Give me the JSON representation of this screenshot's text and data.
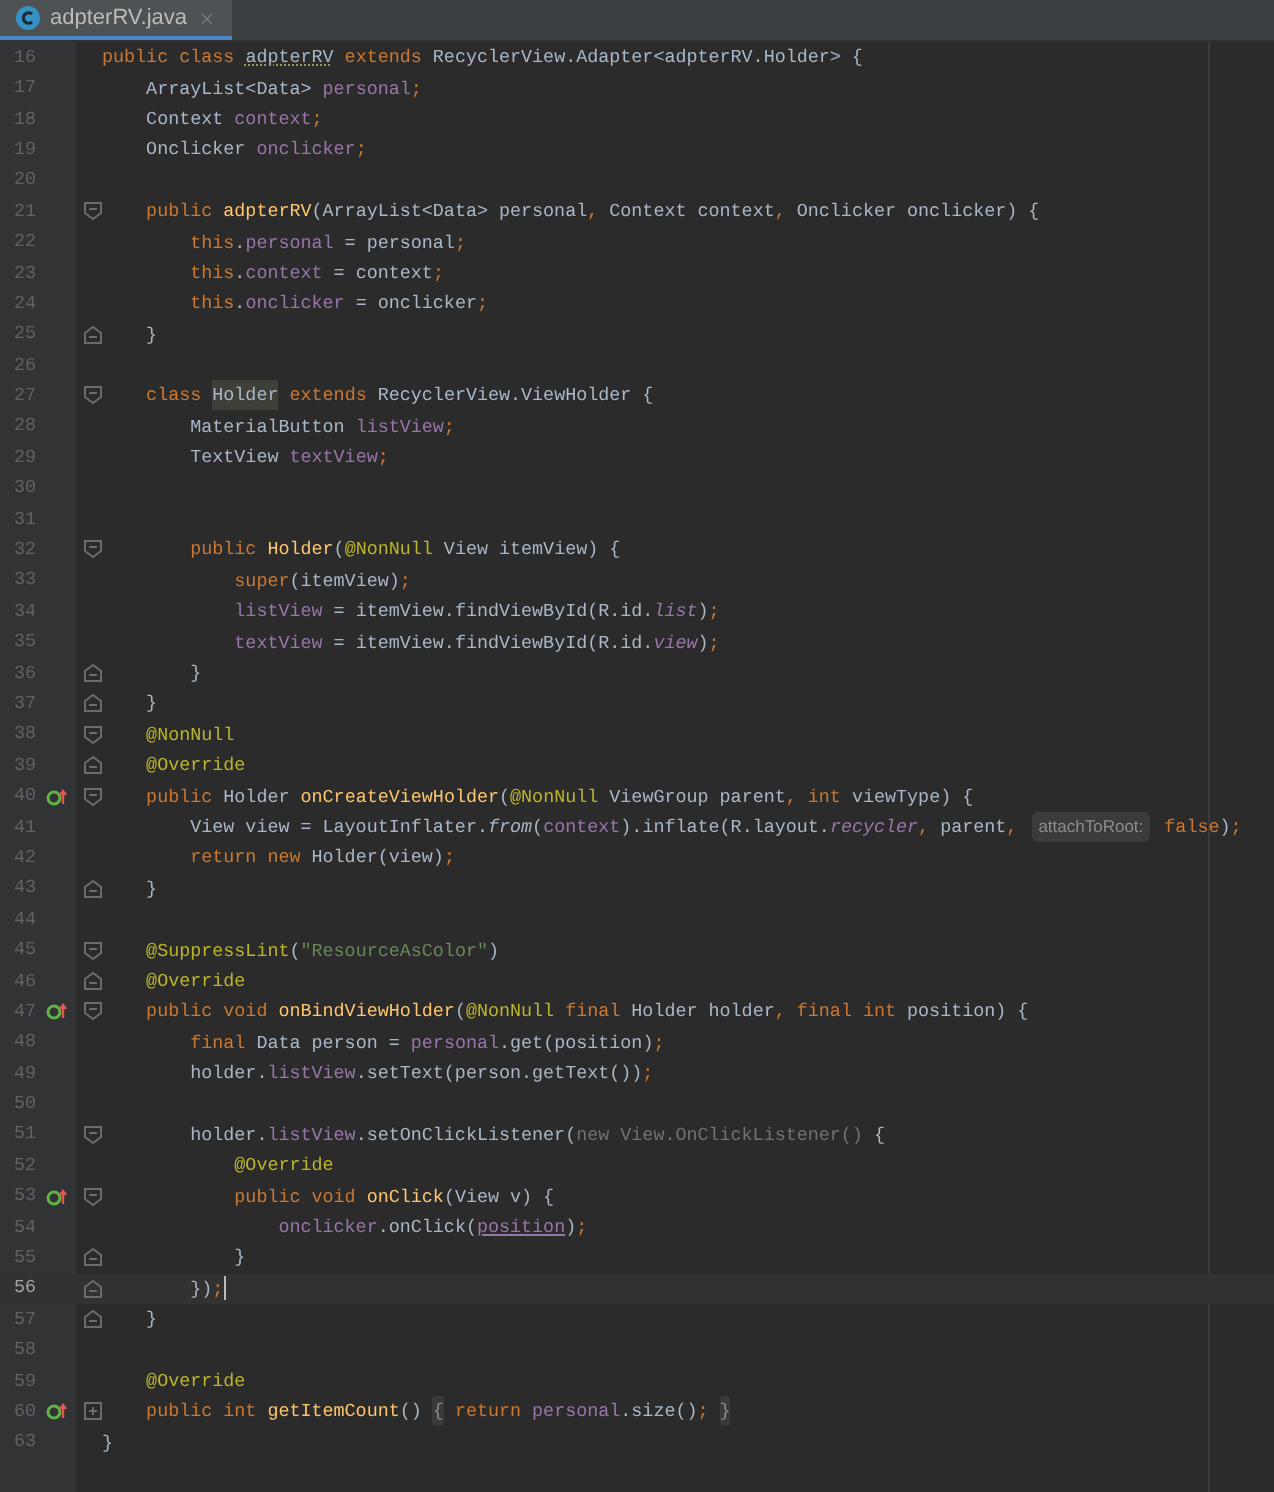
{
  "tab": {
    "title": "adpterRV.java",
    "selected": true
  },
  "lines": [
    {
      "number": "16",
      "current": false,
      "overrides": false,
      "tokens": [
        {
          "kind": "kw",
          "text": "public class "
        },
        {
          "kind": "typo",
          "text": "adpterRV"
        },
        {
          "kind": "kw",
          "text": " extends "
        },
        {
          "kind": "plain",
          "text": "RecyclerView.Adapter<adpterRV.Holder> {"
        }
      ]
    },
    {
      "number": "17",
      "current": false,
      "overrides": false,
      "tokens": [
        {
          "kind": "plain",
          "text": "    ArrayList<Data> "
        },
        {
          "kind": "field",
          "text": "personal"
        },
        {
          "kind": "kw",
          "text": ";"
        }
      ]
    },
    {
      "number": "18",
      "current": false,
      "overrides": false,
      "tokens": [
        {
          "kind": "plain",
          "text": "    Context "
        },
        {
          "kind": "field",
          "text": "context"
        },
        {
          "kind": "kw",
          "text": ";"
        }
      ]
    },
    {
      "number": "19",
      "current": false,
      "overrides": false,
      "tokens": [
        {
          "kind": "plain",
          "text": "    Onclicker "
        },
        {
          "kind": "field",
          "text": "onclicker"
        },
        {
          "kind": "kw",
          "text": ";"
        }
      ]
    },
    {
      "number": "20",
      "current": false,
      "overrides": false
    },
    {
      "number": "21",
      "current": false,
      "overrides": false,
      "fold_marker": {
        "kind": "start"
      },
      "tokens": [
        {
          "kind": "kw",
          "text": "    public "
        },
        {
          "kind": "method",
          "text": "adpterRV"
        },
        {
          "kind": "plain",
          "text": "(ArrayList<Data> personal"
        },
        {
          "kind": "kw",
          "text": ", "
        },
        {
          "kind": "plain",
          "text": "Context context"
        },
        {
          "kind": "kw",
          "text": ", "
        },
        {
          "kind": "plain",
          "text": "Onclicker onclicker) {"
        }
      ]
    },
    {
      "number": "22",
      "current": false,
      "overrides": false,
      "tokens": [
        {
          "kind": "kw",
          "text": "        this"
        },
        {
          "kind": "plain",
          "text": "."
        },
        {
          "kind": "field",
          "text": "personal"
        },
        {
          "kind": "plain",
          "text": " = personal"
        },
        {
          "kind": "kw",
          "text": ";"
        }
      ]
    },
    {
      "number": "23",
      "current": false,
      "overrides": false,
      "tokens": [
        {
          "kind": "kw",
          "text": "        this"
        },
        {
          "kind": "plain",
          "text": "."
        },
        {
          "kind": "field",
          "text": "context"
        },
        {
          "kind": "plain",
          "text": " = context"
        },
        {
          "kind": "kw",
          "text": ";"
        }
      ]
    },
    {
      "number": "24",
      "current": false,
      "overrides": false,
      "tokens": [
        {
          "kind": "kw",
          "text": "        this"
        },
        {
          "kind": "plain",
          "text": "."
        },
        {
          "kind": "field",
          "text": "onclicker"
        },
        {
          "kind": "plain",
          "text": " = onclicker"
        },
        {
          "kind": "kw",
          "text": ";"
        }
      ]
    },
    {
      "number": "25",
      "current": false,
      "overrides": false,
      "fold_marker": {
        "kind": "end"
      },
      "tokens": [
        {
          "kind": "plain",
          "text": "    }"
        }
      ]
    },
    {
      "number": "26",
      "current": false,
      "overrides": false
    },
    {
      "number": "27",
      "current": false,
      "overrides": false,
      "fold_marker": {
        "kind": "start"
      },
      "tokens": [
        {
          "kind": "kw",
          "text": "    class "
        },
        {
          "kind": "usage",
          "text": "Holder"
        },
        {
          "kind": "kw",
          "text": " extends "
        },
        {
          "kind": "plain",
          "text": "RecyclerView.ViewHolder {"
        }
      ]
    },
    {
      "number": "28",
      "current": false,
      "overrides": false,
      "tokens": [
        {
          "kind": "plain",
          "text": "        MaterialButton "
        },
        {
          "kind": "field",
          "text": "listView"
        },
        {
          "kind": "kw",
          "text": ";"
        }
      ]
    },
    {
      "number": "29",
      "current": false,
      "overrides": false,
      "tokens": [
        {
          "kind": "plain",
          "text": "        TextView "
        },
        {
          "kind": "field",
          "text": "textView"
        },
        {
          "kind": "kw",
          "text": ";"
        }
      ]
    },
    {
      "number": "30",
      "current": false,
      "overrides": false
    },
    {
      "number": "31",
      "current": false,
      "overrides": false
    },
    {
      "number": "32",
      "current": false,
      "overrides": false,
      "fold_marker": {
        "kind": "start"
      },
      "tokens": [
        {
          "kind": "kw",
          "text": "        public "
        },
        {
          "kind": "method",
          "text": "Holder"
        },
        {
          "kind": "plain",
          "text": "("
        },
        {
          "kind": "ann",
          "text": "@NonNull"
        },
        {
          "kind": "plain",
          "text": " View itemView) {"
        }
      ]
    },
    {
      "number": "33",
      "current": false,
      "overrides": false,
      "tokens": [
        {
          "kind": "kw",
          "text": "            super"
        },
        {
          "kind": "plain",
          "text": "(itemView)"
        },
        {
          "kind": "kw",
          "text": ";"
        }
      ]
    },
    {
      "number": "34",
      "current": false,
      "overrides": false,
      "tokens": [
        {
          "kind": "field",
          "text": "            listView"
        },
        {
          "kind": "plain",
          "text": " = itemView.findViewById(R.id."
        },
        {
          "kind": "static",
          "text": "list"
        },
        {
          "kind": "plain",
          "text": ")"
        },
        {
          "kind": "kw",
          "text": ";"
        }
      ]
    },
    {
      "number": "35",
      "current": false,
      "overrides": false,
      "tokens": [
        {
          "kind": "field",
          "text": "            textView"
        },
        {
          "kind": "plain",
          "text": " = itemView.findViewById(R.id."
        },
        {
          "kind": "static",
          "text": "view"
        },
        {
          "kind": "plain",
          "text": ")"
        },
        {
          "kind": "kw",
          "text": ";"
        }
      ]
    },
    {
      "number": "36",
      "current": false,
      "overrides": false,
      "fold_marker": {
        "kind": "end"
      },
      "tokens": [
        {
          "kind": "plain",
          "text": "        }"
        }
      ]
    },
    {
      "number": "37",
      "current": false,
      "overrides": false,
      "fold_marker": {
        "kind": "end"
      },
      "tokens": [
        {
          "kind": "plain",
          "text": "    }"
        }
      ]
    },
    {
      "number": "38",
      "current": false,
      "overrides": false,
      "fold_marker": {
        "kind": "start"
      },
      "tokens": [
        {
          "kind": "ann",
          "text": "    @NonNull"
        }
      ]
    },
    {
      "number": "39",
      "current": false,
      "overrides": false,
      "fold_marker": {
        "kind": "end"
      },
      "tokens": [
        {
          "kind": "ann",
          "text": "    @Override"
        }
      ]
    },
    {
      "number": "40",
      "current": false,
      "overrides": true,
      "fold_marker": {
        "kind": "start"
      },
      "tokens": [
        {
          "kind": "kw",
          "text": "    public "
        },
        {
          "kind": "plain",
          "text": "Holder "
        },
        {
          "kind": "method",
          "text": "onCreateViewHolder"
        },
        {
          "kind": "plain",
          "text": "("
        },
        {
          "kind": "ann",
          "text": "@NonNull"
        },
        {
          "kind": "plain",
          "text": " ViewGroup parent"
        },
        {
          "kind": "kw",
          "text": ", int "
        },
        {
          "kind": "plain",
          "text": "viewType) {"
        }
      ]
    },
    {
      "number": "41",
      "current": false,
      "overrides": false,
      "tokens": [
        {
          "kind": "plain",
          "text": "        View view = LayoutInflater."
        },
        {
          "kind": "italic",
          "text": "from"
        },
        {
          "kind": "plain",
          "text": "("
        },
        {
          "kind": "field",
          "text": "context"
        },
        {
          "kind": "plain",
          "text": ").inflate(R.layout."
        },
        {
          "kind": "static",
          "text": "recycler"
        },
        {
          "kind": "kw",
          "text": ", "
        },
        {
          "kind": "plain",
          "text": "parent"
        },
        {
          "kind": "kw",
          "text": ", "
        },
        {
          "kind": "hint",
          "text": "attachToRoot:"
        },
        {
          "kind": "kw",
          "text": " false"
        },
        {
          "kind": "plain",
          "text": ")"
        },
        {
          "kind": "kw",
          "text": ";"
        }
      ]
    },
    {
      "number": "42",
      "current": false,
      "overrides": false,
      "tokens": [
        {
          "kind": "kw",
          "text": "        return new "
        },
        {
          "kind": "plain",
          "text": "Holder(view)"
        },
        {
          "kind": "kw",
          "text": ";"
        }
      ]
    },
    {
      "number": "43",
      "current": false,
      "overrides": false,
      "fold_marker": {
        "kind": "end"
      },
      "tokens": [
        {
          "kind": "plain",
          "text": "    }"
        }
      ]
    },
    {
      "number": "44",
      "current": false,
      "overrides": false
    },
    {
      "number": "45",
      "current": false,
      "overrides": false,
      "fold_marker": {
        "kind": "start"
      },
      "tokens": [
        {
          "kind": "ann",
          "text": "    @SuppressLint"
        },
        {
          "kind": "plain",
          "text": "("
        },
        {
          "kind": "string",
          "text": "\"ResourceAsColor\""
        },
        {
          "kind": "plain",
          "text": ")"
        }
      ]
    },
    {
      "number": "46",
      "current": false,
      "overrides": false,
      "fold_marker": {
        "kind": "end"
      },
      "tokens": [
        {
          "kind": "ann",
          "text": "    @Override"
        }
      ]
    },
    {
      "number": "47",
      "current": false,
      "overrides": true,
      "fold_marker": {
        "kind": "start"
      },
      "tokens": [
        {
          "kind": "kw",
          "text": "    public void "
        },
        {
          "kind": "method",
          "text": "onBindViewHolder"
        },
        {
          "kind": "plain",
          "text": "("
        },
        {
          "kind": "ann",
          "text": "@NonNull"
        },
        {
          "kind": "kw",
          "text": " final "
        },
        {
          "kind": "plain",
          "text": "Holder holder"
        },
        {
          "kind": "kw",
          "text": ", final int "
        },
        {
          "kind": "plain",
          "text": "position) {"
        }
      ]
    },
    {
      "number": "48",
      "current": false,
      "overrides": false,
      "tokens": [
        {
          "kind": "kw",
          "text": "        final "
        },
        {
          "kind": "plain",
          "text": "Data person = "
        },
        {
          "kind": "field",
          "text": "personal"
        },
        {
          "kind": "plain",
          "text": ".get(position)"
        },
        {
          "kind": "kw",
          "text": ";"
        }
      ]
    },
    {
      "number": "49",
      "current": false,
      "overrides": false,
      "tokens": [
        {
          "kind": "plain",
          "text": "        holder."
        },
        {
          "kind": "field",
          "text": "listView"
        },
        {
          "kind": "plain",
          "text": ".setText(person.getText())"
        },
        {
          "kind": "kw",
          "text": ";"
        }
      ]
    },
    {
      "number": "50",
      "current": false,
      "overrides": false
    },
    {
      "number": "51",
      "current": false,
      "overrides": false,
      "fold_marker": {
        "kind": "start"
      },
      "tokens": [
        {
          "kind": "plain",
          "text": "        holder."
        },
        {
          "kind": "field",
          "text": "listView"
        },
        {
          "kind": "plain",
          "text": ".setOnClickListener("
        },
        {
          "kind": "grey",
          "text": "new View.OnClickListener() "
        },
        {
          "kind": "plain",
          "text": "{"
        }
      ]
    },
    {
      "number": "52",
      "current": false,
      "overrides": false,
      "tokens": [
        {
          "kind": "ann",
          "text": "            @Override"
        }
      ]
    },
    {
      "number": "53",
      "current": false,
      "overrides": true,
      "fold_marker": {
        "kind": "start"
      },
      "tokens": [
        {
          "kind": "kw",
          "text": "            public void "
        },
        {
          "kind": "method",
          "text": "onClick"
        },
        {
          "kind": "plain",
          "text": "(View v) {"
        }
      ]
    },
    {
      "number": "54",
      "current": false,
      "overrides": false,
      "tokens": [
        {
          "kind": "field",
          "text": "                onclicker"
        },
        {
          "kind": "plain",
          "text": ".onClick("
        },
        {
          "kind": "captured",
          "text": "position"
        },
        {
          "kind": "plain",
          "text": ")"
        },
        {
          "kind": "kw",
          "text": ";"
        }
      ]
    },
    {
      "number": "55",
      "current": false,
      "overrides": false,
      "fold_marker": {
        "kind": "end"
      },
      "tokens": [
        {
          "kind": "plain",
          "text": "            }"
        }
      ]
    },
    {
      "number": "56",
      "current": true,
      "overrides": false,
      "fold_marker": {
        "kind": "end"
      },
      "tokens": [
        {
          "kind": "plain",
          "text": "        })"
        },
        {
          "kind": "kw",
          "text": ";"
        }
      ]
    },
    {
      "number": "57",
      "current": false,
      "overrides": false,
      "fold_marker": {
        "kind": "end"
      },
      "tokens": [
        {
          "kind": "plain",
          "text": "    }"
        }
      ]
    },
    {
      "number": "58",
      "current": false,
      "overrides": false
    },
    {
      "number": "59",
      "current": false,
      "overrides": false,
      "tokens": [
        {
          "kind": "ann",
          "text": "    @Override"
        }
      ]
    },
    {
      "number": "60",
      "current": false,
      "overrides": true,
      "fold_marker": {
        "kind": "collapsed"
      },
      "tokens": [
        {
          "kind": "kw",
          "text": "    public int "
        },
        {
          "kind": "method",
          "text": "getItemCount"
        },
        {
          "kind": "plain",
          "text": "() "
        },
        {
          "kind": "folded",
          "text": "{"
        },
        {
          "kind": "kw",
          "text": " return "
        },
        {
          "kind": "field",
          "text": "personal"
        },
        {
          "kind": "plain",
          "text": ".size()"
        },
        {
          "kind": "kw",
          "text": "; "
        },
        {
          "kind": "folded",
          "text": "}"
        }
      ]
    },
    {
      "number": "63",
      "current": false,
      "overrides": false,
      "tokens": [
        {
          "kind": "plain",
          "text": "}"
        }
      ]
    }
  ]
}
